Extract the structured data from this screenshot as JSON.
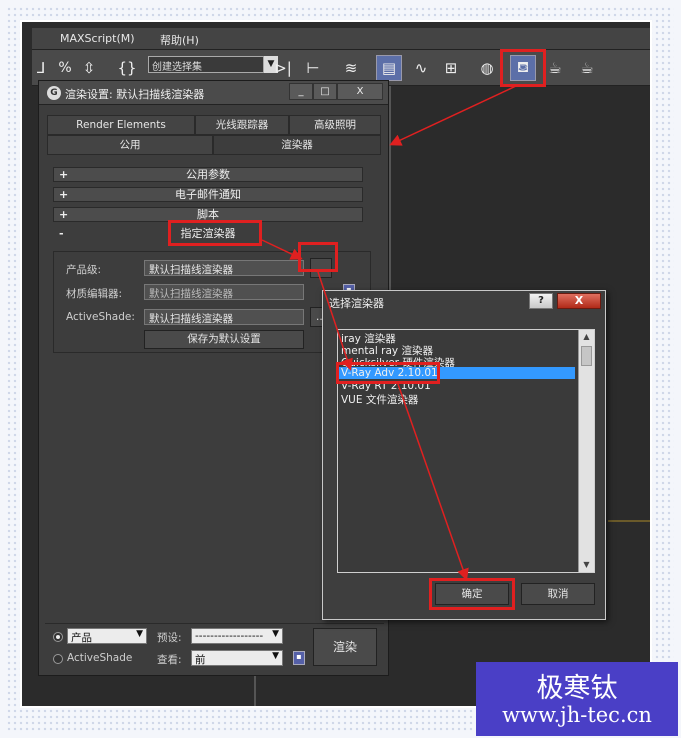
{
  "menu": {
    "maxscript": "MAXScript(M)",
    "help": "帮助(H)"
  },
  "toolbar": {
    "selection_set": "创建选择集"
  },
  "render_setup": {
    "title": "渲染设置: 默认扫描线渲染器",
    "tabs_row1": [
      "Render Elements",
      "光线跟踪器",
      "高级照明"
    ],
    "tabs_row2": [
      "公用",
      "渲染器"
    ],
    "rollouts": [
      {
        "sign": "+",
        "label": "公用参数"
      },
      {
        "sign": "+",
        "label": "电子邮件通知"
      },
      {
        "sign": "+",
        "label": "脚本"
      },
      {
        "sign": "-",
        "label": "指定渲染器"
      }
    ],
    "assign": {
      "production_label": "产品级:",
      "production_value": "默认扫描线渲染器",
      "material_label": "材质编辑器:",
      "material_value": "默认扫描线渲染器",
      "activeshade_label": "ActiveShade:",
      "activeshade_value": "默认扫描线渲染器",
      "browse": "...",
      "save_default": "保存为默认设置"
    },
    "bottom": {
      "production_radio": "产品",
      "activeshade_radio": "ActiveShade",
      "preset_label": "预设:",
      "preset_value": "------------------",
      "view_label": "查看:",
      "view_value": "前",
      "render_button": "渲染"
    }
  },
  "choose_renderer": {
    "title": "选择渲染器",
    "help": "?",
    "close": "X",
    "items": [
      "iray 渲染器",
      "mental ray 渲染器",
      "Quicksilver 硬件渲染器",
      "V-Ray Adv 2.10.01",
      "V-Ray RT 2.10.01",
      "VUE 文件渲染器"
    ],
    "selected_index": 3,
    "ok": "确定",
    "cancel": "取消"
  },
  "watermark": {
    "line1": "极寒钛",
    "line2": "www.jh-tec.cn"
  }
}
